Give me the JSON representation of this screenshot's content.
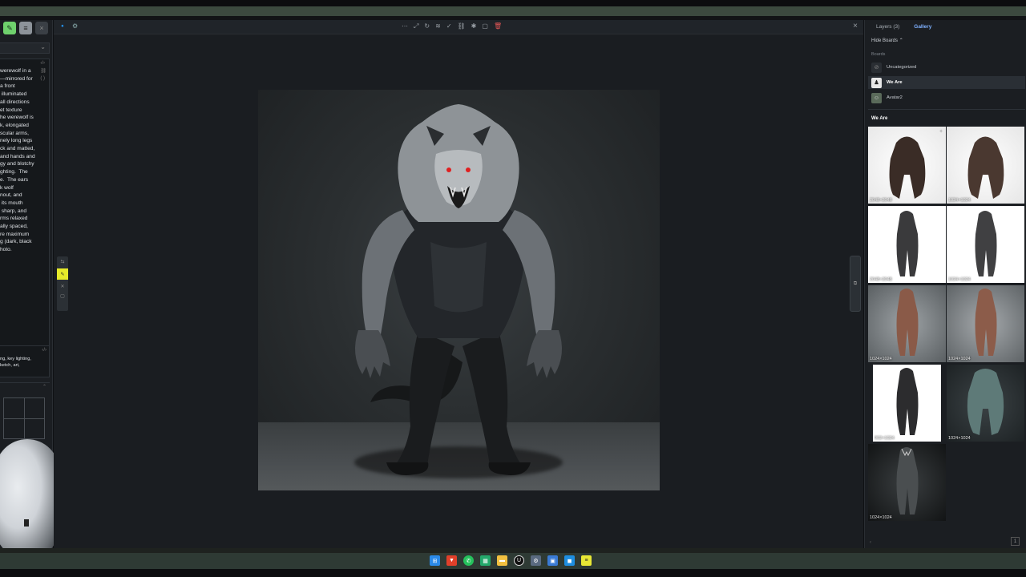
{
  "left_panel": {
    "prompt_text": "werewolf in a\n—mirrored for\na front\n illuminated\nall directions\net texture\nhe werewolf is\nk, elongated\nscular arms,\nnely long legs\nck and matted,\nand hands and\ngy and blotchy\nghting.  The\ne.  The ears\nk wolf\nnout, and\n its mouth\n sharp, and\nrms relaxed\nally spaced,\nre maximum\ng (dark, black\nhoto.",
    "negative_text": "ng, key lighting,\nketch, art,"
  },
  "canvas": {
    "toolbar_left": [
      "🔹",
      "⚙"
    ],
    "toolbar_center": [
      "⋯",
      "⤢",
      "↻",
      "≋",
      "✓",
      "⛓",
      "✱",
      "▢"
    ],
    "delete_icon": "🗑",
    "close": "×"
  },
  "right_panel": {
    "tab_layers": "Layers (3)",
    "tab_gallery": "Gallery",
    "hide_boards": "Hide Boards",
    "boards_label": "Boards",
    "boards": [
      {
        "name": "Uncategorized",
        "selected": false
      },
      {
        "name": "We Are",
        "selected": true
      },
      {
        "name": "Avatar2",
        "selected": false
      }
    ],
    "board_title": "We Are",
    "thumbnails": [
      {
        "dim": "2048×2048",
        "starred": true
      },
      {
        "dim": "1024×1024",
        "starred": false
      },
      {
        "dim": "2048×2048",
        "starred": false
      },
      {
        "dim": "1024×1024",
        "starred": false
      },
      {
        "dim": "1024×1024",
        "starred": false
      },
      {
        "dim": "1024×1024",
        "starred": false
      },
      {
        "dim": "902×1024",
        "starred": false
      },
      {
        "dim": "1024×1024",
        "starred": false
      },
      {
        "dim": "1024×1024",
        "starred": false
      }
    ],
    "page_indicator": "1"
  },
  "taskbar": {
    "icons": [
      "windows-icon",
      "brave-icon",
      "whatsapp-icon",
      "sheets-icon",
      "folder-icon",
      "unreal-icon",
      "settings-icon",
      "photos-icon",
      "store-icon",
      "notes-icon"
    ]
  }
}
